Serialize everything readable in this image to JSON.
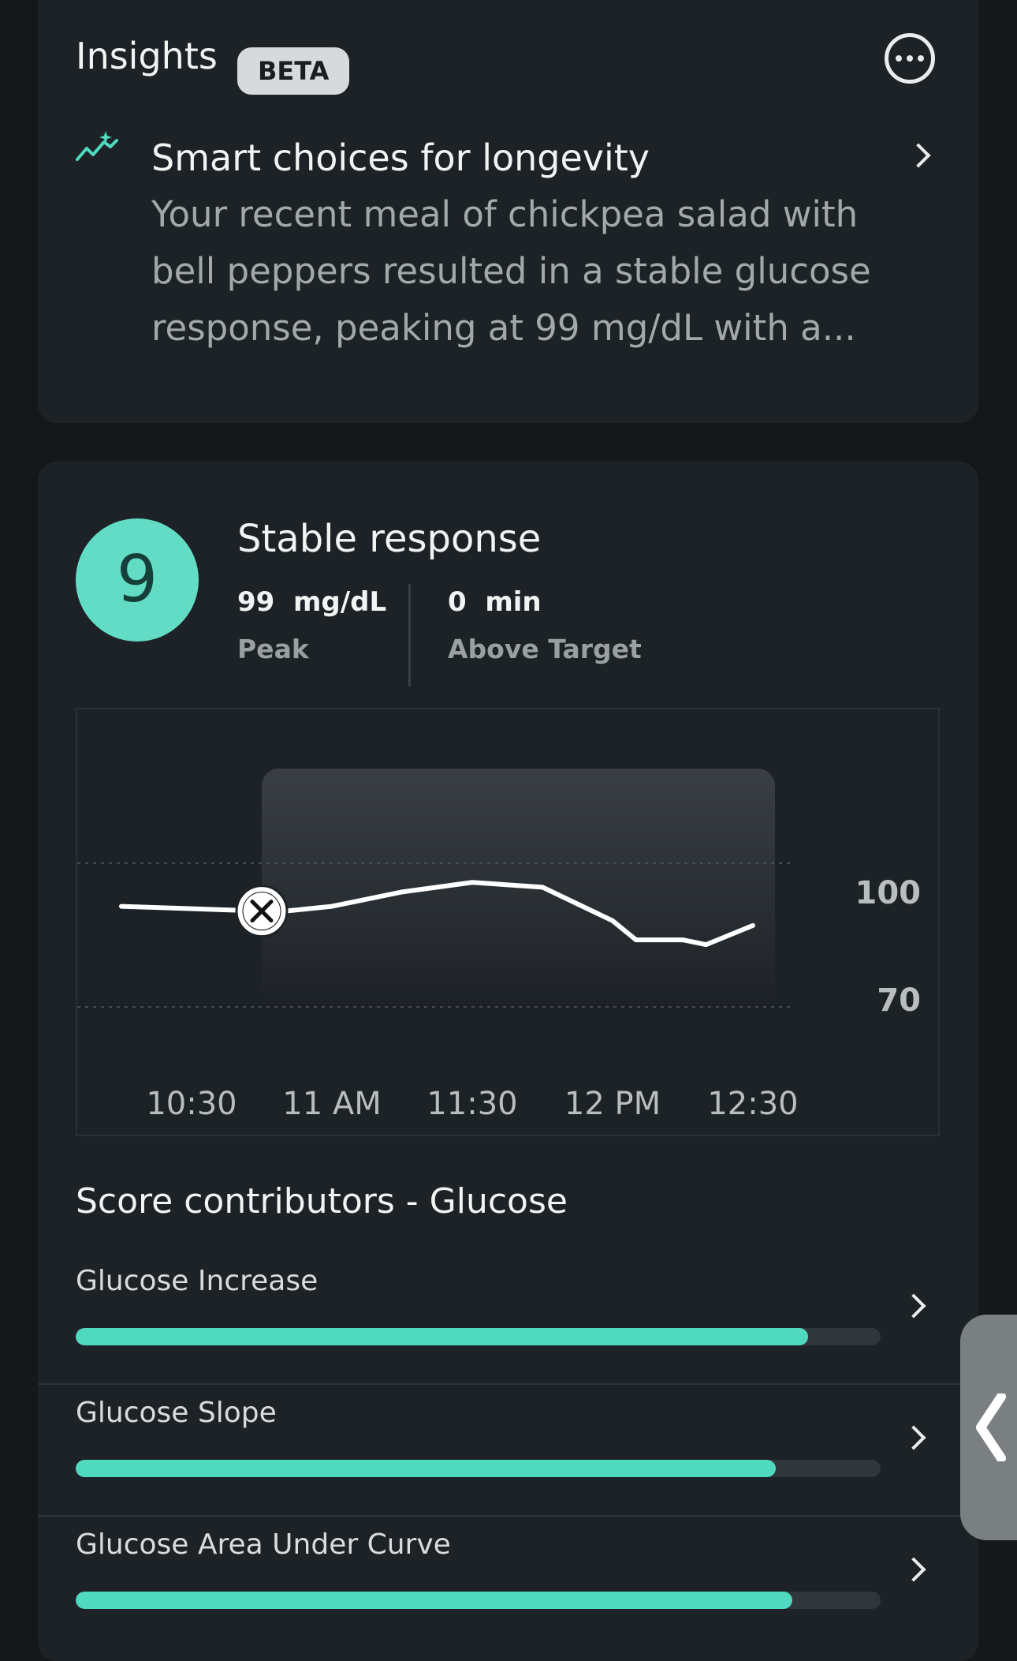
{
  "insights": {
    "title": "Insights",
    "badge": "BETA",
    "more_icon": "more-horizontal-icon",
    "item": {
      "icon": "sparkle-trend-icon",
      "heading": "Smart choices for longevity",
      "body": "Your recent meal of chickpea salad with bell peppers resulted in a stable glucose response, peaking at 99 mg/dL with a..."
    }
  },
  "response": {
    "score": "9",
    "title": "Stable response",
    "peak_value": "99  mg/dL",
    "peak_label": "Peak",
    "above_value": "0  min",
    "above_label": "Above Target",
    "colors": {
      "score": "#62dcc5",
      "bar": "#4fd9bf"
    }
  },
  "chart_data": {
    "type": "line",
    "x_ticks": [
      "10:30",
      "11 AM",
      "11:30",
      "12 PM",
      "12:30"
    ],
    "y_ticks": [
      "100",
      "70"
    ],
    "ylim": [
      55,
      115
    ],
    "meal_marker_time": "10:45",
    "meal_icon": "fork-knife-icon",
    "series": [
      {
        "x": [
          "10:15",
          "10:45",
          "10:50",
          "11:00",
          "11:15",
          "11:30",
          "11:45",
          "12:00",
          "12:05",
          "12:15",
          "12:20",
          "12:25",
          "12:30"
        ],
        "y": [
          91,
          90,
          90,
          91,
          94,
          96,
          95,
          88,
          84,
          84,
          83,
          85,
          87
        ]
      }
    ]
  },
  "contributors": {
    "title": "Score contributors - Glucose",
    "items": [
      {
        "label": "Glucose Increase",
        "value": 0.91
      },
      {
        "label": "Glucose Slope",
        "value": 0.87
      },
      {
        "label": "Glucose Area Under Curve",
        "value": 0.89
      }
    ]
  },
  "side_tab": {
    "icon": "chevron-left-icon"
  }
}
